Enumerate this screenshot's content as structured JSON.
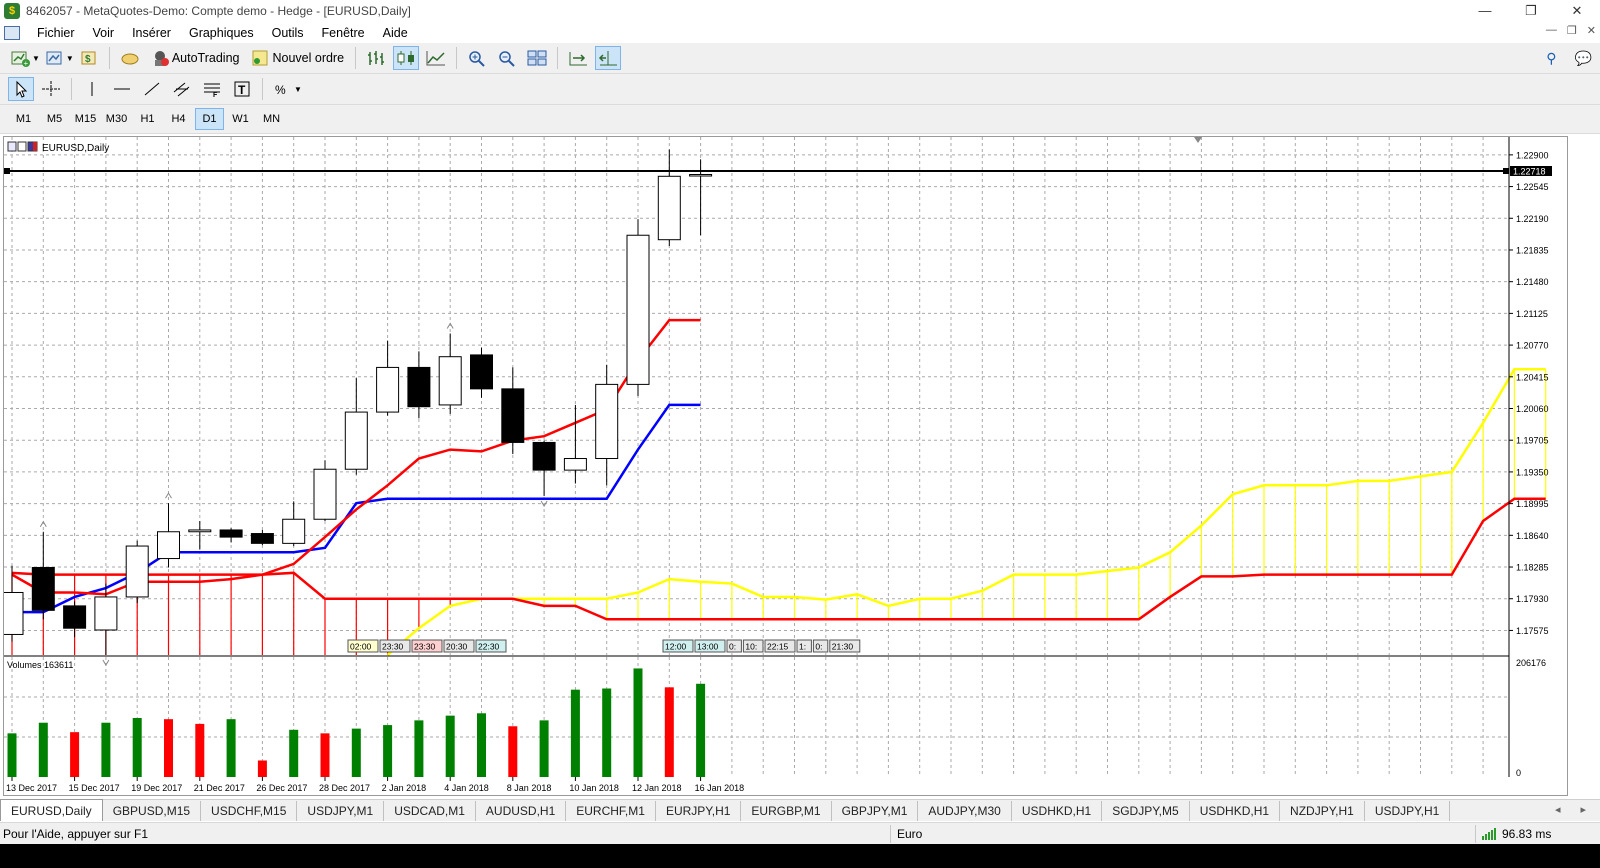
{
  "window": {
    "title": "8462057 - MetaQuotes-Demo: Compte demo - Hedge - [EURUSD,Daily]",
    "buttons": [
      "—",
      "❐",
      "✕"
    ]
  },
  "menu": [
    "Fichier",
    "Voir",
    "Insérer",
    "Graphiques",
    "Outils",
    "Fenêtre",
    "Aide"
  ],
  "toolbar": {
    "autotrading_label": "AutoTrading",
    "new_order_label": "Nouvel ordre"
  },
  "timeframes": [
    "M1",
    "M5",
    "M15",
    "M30",
    "H1",
    "H4",
    "D1",
    "W1",
    "MN"
  ],
  "active_timeframe": "D1",
  "chart": {
    "symbol_label": "EURUSD,Daily",
    "current_price_label": "1.22718",
    "volume_label": "Volumes 163611",
    "volume_scale_top": "206176",
    "volume_scale_bottom": "0",
    "price_ticks": [
      "1.22900",
      "1.22545",
      "1.22190",
      "1.21835",
      "1.21480",
      "1.21125",
      "1.20770",
      "1.20415",
      "1.20060",
      "1.19705",
      "1.19350",
      "1.18995",
      "1.18640",
      "1.18285",
      "1.17930",
      "1.17575"
    ],
    "date_labels": [
      "13 Dec 2017",
      "15 Dec 2017",
      "19 Dec 2017",
      "21 Dec 2017",
      "26 Dec 2017",
      "28 Dec 2017",
      "2 Jan 2018",
      "4 Jan 2018",
      "8 Jan 2018",
      "10 Jan 2018",
      "12 Jan 2018",
      "16 Jan 2018"
    ],
    "time_markers_left": [
      "02:00",
      "23:30",
      "23:30",
      "20:30",
      "22:30"
    ],
    "time_markers_right": [
      "12:00",
      "13:00",
      "0:",
      "10:",
      "22:15",
      "1:",
      "0:",
      "21:30"
    ]
  },
  "chart_data": {
    "type": "candlestick",
    "title": "EURUSD,Daily",
    "ylim": [
      1.173,
      1.231
    ],
    "candles": [
      {
        "o": 1.1753,
        "h": 1.183,
        "l": 1.1745,
        "c": 1.18
      },
      {
        "o": 1.1828,
        "h": 1.1868,
        "l": 1.177,
        "c": 1.178
      },
      {
        "o": 1.1785,
        "h": 1.179,
        "l": 1.175,
        "c": 1.176
      },
      {
        "o": 1.1758,
        "h": 1.181,
        "l": 1.173,
        "c": 1.1795
      },
      {
        "o": 1.1795,
        "h": 1.1858,
        "l": 1.1788,
        "c": 1.1852
      },
      {
        "o": 1.1838,
        "h": 1.19,
        "l": 1.1828,
        "c": 1.1868
      },
      {
        "o": 1.1868,
        "h": 1.188,
        "l": 1.1848,
        "c": 1.187
      },
      {
        "o": 1.187,
        "h": 1.1872,
        "l": 1.1856,
        "c": 1.1862
      },
      {
        "o": 1.1866,
        "h": 1.187,
        "l": 1.1853,
        "c": 1.1855
      },
      {
        "o": 1.1855,
        "h": 1.1902,
        "l": 1.1852,
        "c": 1.1882
      },
      {
        "o": 1.1882,
        "h": 1.1948,
        "l": 1.188,
        "c": 1.1938
      },
      {
        "o": 1.1938,
        "h": 1.204,
        "l": 1.1932,
        "c": 1.2002
      },
      {
        "o": 1.2002,
        "h": 1.2082,
        "l": 1.1998,
        "c": 1.2052
      },
      {
        "o": 1.2052,
        "h": 1.207,
        "l": 1.1995,
        "c": 1.2008
      },
      {
        "o": 1.201,
        "h": 1.209,
        "l": 1.2,
        "c": 1.2064
      },
      {
        "o": 1.2066,
        "h": 1.2074,
        "l": 1.2018,
        "c": 1.2028
      },
      {
        "o": 1.2028,
        "h": 1.2052,
        "l": 1.1955,
        "c": 1.1968
      },
      {
        "o": 1.1968,
        "h": 1.197,
        "l": 1.1908,
        "c": 1.1937
      },
      {
        "o": 1.1937,
        "h": 1.201,
        "l": 1.1922,
        "c": 1.195
      },
      {
        "o": 1.195,
        "h": 1.2055,
        "l": 1.192,
        "c": 1.2033
      },
      {
        "o": 1.2033,
        "h": 1.2218,
        "l": 1.202,
        "c": 1.22
      },
      {
        "o": 1.2195,
        "h": 1.2296,
        "l": 1.2188,
        "c": 1.2266
      },
      {
        "o": 1.2268,
        "h": 1.2285,
        "l": 1.22,
        "c": 1.2268
      }
    ],
    "series": [
      {
        "name": "tenkan",
        "color": "#0000ff",
        "values": [
          1.1778,
          1.1778,
          1.1795,
          1.1805,
          1.1822,
          1.1845,
          1.1845,
          1.1845,
          1.1845,
          1.1845,
          1.185,
          1.19,
          1.1905,
          1.1905,
          1.1905,
          1.1905,
          1.1905,
          1.1905,
          1.1905,
          1.1905,
          1.196,
          1.201,
          1.201
        ]
      },
      {
        "name": "kijun",
        "color": "#ff0000",
        "values": [
          1.182,
          1.18,
          1.18,
          1.1798,
          1.1812,
          1.1812,
          1.1812,
          1.1815,
          1.182,
          1.1832,
          1.1862,
          1.1893,
          1.192,
          1.195,
          1.196,
          1.1958,
          1.197,
          1.1975,
          1.199,
          1.2005,
          1.206,
          1.2105,
          1.2105
        ]
      },
      {
        "name": "senkou_a",
        "color": "#ffff00",
        "start": 12,
        "values": [
          1.173,
          1.176,
          1.1785,
          1.1793,
          1.1793,
          1.1793,
          1.1793,
          1.1793,
          1.18,
          1.1815,
          1.1812,
          1.181,
          1.1795,
          1.1795,
          1.1792,
          1.1798,
          1.1785,
          1.1793,
          1.1793,
          1.1802,
          1.182,
          1.182,
          1.182,
          1.1824,
          1.1828,
          1.1845,
          1.1875,
          1.191,
          1.192,
          1.192,
          1.192,
          1.1925,
          1.1925,
          1.193,
          1.1935,
          1.199,
          1.205,
          1.205
        ]
      },
      {
        "name": "senkou_b",
        "color": "#ff0000",
        "start": 0,
        "values": [
          1.1822,
          1.182,
          1.182,
          1.182,
          1.182,
          1.182,
          1.182,
          1.182,
          1.182,
          1.1822,
          1.1793,
          1.1793,
          1.1793,
          1.1793,
          1.1793,
          1.1793,
          1.1793,
          1.1785,
          1.1785,
          1.177,
          1.177,
          1.177,
          1.177,
          1.177,
          1.177,
          1.177,
          1.177,
          1.177,
          1.177,
          1.177,
          1.177,
          1.177,
          1.177,
          1.177,
          1.177,
          1.177,
          1.177,
          1.1795,
          1.1818,
          1.1818,
          1.182,
          1.182,
          1.182,
          1.182,
          1.182,
          1.182,
          1.182,
          1.188,
          1.1905,
          1.1905
        ]
      }
    ],
    "volumes": [
      {
        "v": 0.37,
        "up": true
      },
      {
        "v": 0.46,
        "up": true
      },
      {
        "v": 0.38,
        "up": false
      },
      {
        "v": 0.46,
        "up": true
      },
      {
        "v": 0.5,
        "up": true
      },
      {
        "v": 0.49,
        "up": false
      },
      {
        "v": 0.45,
        "up": false
      },
      {
        "v": 0.49,
        "up": true
      },
      {
        "v": 0.14,
        "up": false
      },
      {
        "v": 0.4,
        "up": true
      },
      {
        "v": 0.37,
        "up": false
      },
      {
        "v": 0.41,
        "up": true
      },
      {
        "v": 0.44,
        "up": true
      },
      {
        "v": 0.48,
        "up": true
      },
      {
        "v": 0.52,
        "up": true
      },
      {
        "v": 0.54,
        "up": true
      },
      {
        "v": 0.43,
        "up": false
      },
      {
        "v": 0.48,
        "up": true
      },
      {
        "v": 0.74,
        "up": true
      },
      {
        "v": 0.75,
        "up": true
      },
      {
        "v": 0.92,
        "up": true
      },
      {
        "v": 0.76,
        "up": false
      },
      {
        "v": 0.79,
        "up": true
      }
    ]
  },
  "symbol_tabs": [
    "EURUSD,Daily",
    "GBPUSD,M15",
    "USDCHF,M15",
    "USDJPY,M1",
    "USDCAD,M1",
    "AUDUSD,H1",
    "EURCHF,M1",
    "EURJPY,H1",
    "EURGBP,M1",
    "GBPJPY,M1",
    "AUDJPY,M30",
    "USDHKD,H1",
    "SGDJPY,M5",
    "USDHKD,H1",
    "NZDJPY,H1",
    "USDJPY,H1"
  ],
  "active_symbol_tab": "EURUSD,Daily",
  "status": {
    "help": "Pour l'Aide, appuyer sur F1",
    "profile": "Euro",
    "ping": "96.83 ms"
  }
}
